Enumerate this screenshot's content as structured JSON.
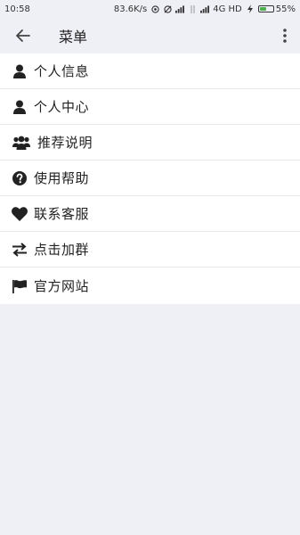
{
  "status_bar": {
    "time": "10:58",
    "net_speed": "83.6K/s",
    "network": "4G HD",
    "battery": "55%",
    "battery_level": 0.55
  },
  "toolbar": {
    "title": "菜单",
    "icons": {
      "back": "back-arrow-icon",
      "more": "more-vertical-icon"
    }
  },
  "menu": {
    "items": [
      {
        "label": "个人信息",
        "icon": "user-icon"
      },
      {
        "label": "个人中心",
        "icon": "user-icon"
      },
      {
        "label": "推荐说明",
        "icon": "users-group-icon"
      },
      {
        "label": "使用帮助",
        "icon": "question-circle-icon"
      },
      {
        "label": "联系客服",
        "icon": "heart-icon"
      },
      {
        "label": "点击加群",
        "icon": "exchange-arrows-icon"
      },
      {
        "label": "官方网站",
        "icon": "flag-icon"
      }
    ]
  },
  "colors": {
    "background": "#efeff6",
    "menu_background": "#ffffff",
    "divider": "#e8e8ee",
    "text": "#222222",
    "battery_fill": "#4caf50"
  }
}
